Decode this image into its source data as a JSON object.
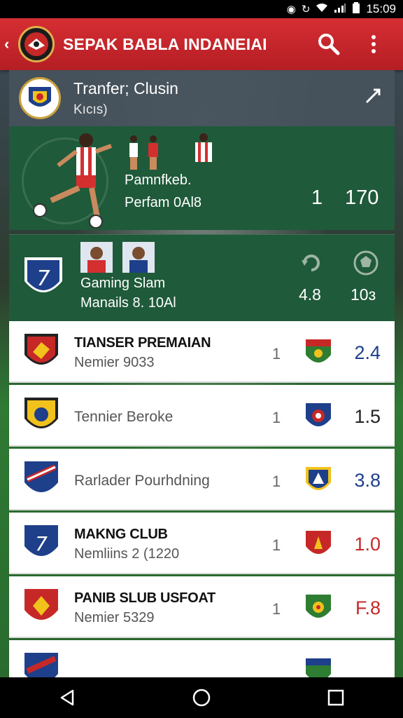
{
  "status_bar": {
    "time": "15:09"
  },
  "app_bar": {
    "back": "‹",
    "title": "SEPAK BABLA INDANEIAI"
  },
  "featured": {
    "title": "Tranfer; Clusin",
    "subtitle": "Kıcıs)",
    "hero": {
      "label": "Pamnfkeb.",
      "sub": "Perfam 0Al8",
      "value_1": "1",
      "value_2": "170"
    },
    "gaming": {
      "label": "Gaming Slam",
      "sub": "Manails 8. 10Al",
      "value_1": "4.8",
      "value_2": "10ɜ"
    }
  },
  "list": [
    {
      "name": "TIANSER PREMAIAN",
      "sub": "Nemier 9033",
      "num": "1",
      "value": "2.4",
      "value_color": "#1e3f8a",
      "crest_color": "#c62828",
      "badge_color": "#c62828"
    },
    {
      "name": "",
      "sub": "Tennier Beroke",
      "num": "1",
      "value": "1.5",
      "value_color": "#222222",
      "crest_color": "#f1c21b",
      "badge_color": "#1e3f8a"
    },
    {
      "name": "",
      "sub": "Rarlader Pourhdning",
      "num": "1",
      "value": "3.8",
      "value_color": "#1e3f8a",
      "crest_color": "#1e3f8a",
      "badge_color": "#f1c21b"
    },
    {
      "name": "MAKNG CLUB",
      "sub": "Nemliins 2 (1220",
      "num": "1",
      "value": "1.0",
      "value_color": "#c62828",
      "crest_color": "#1e3f8a",
      "badge_color": "#c62828"
    },
    {
      "name": "PANIB SLUB USFOAT",
      "sub": "Nemier 5329",
      "num": "1",
      "value": "F.8",
      "value_color": "#c62828",
      "crest_color": "#c62828",
      "badge_color": "#2e7d32"
    }
  ],
  "colors": {
    "app_bar": "#c8262c",
    "panel_green": "#1f5a3a",
    "panel_grey": "#46525c"
  }
}
